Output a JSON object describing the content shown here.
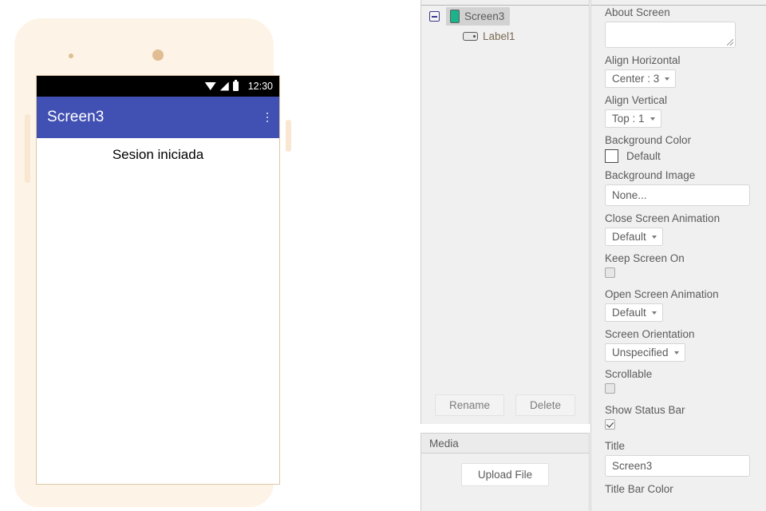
{
  "viewer": {
    "phone": {
      "status_bar": {
        "time": "12:30",
        "icons": [
          "wifi-icon",
          "signal-icon",
          "battery-icon"
        ]
      },
      "title_bar": {
        "title": "Screen3",
        "menu_icon": "overflow-menu-icon"
      },
      "content": {
        "label1_text": "Sesion iniciada"
      }
    }
  },
  "components": {
    "tree": [
      {
        "label": "Screen3",
        "icon": "screen-icon",
        "selected": true,
        "expanded": true
      },
      {
        "label": "Label1",
        "icon": "label-icon",
        "selected": false
      }
    ],
    "rename_label": "Rename",
    "delete_label": "Delete"
  },
  "media": {
    "header": "Media",
    "upload_label": "Upload File"
  },
  "properties": {
    "about_screen": {
      "label": "About Screen",
      "value": ""
    },
    "align_horizontal": {
      "label": "Align Horizontal",
      "value": "Center : 3"
    },
    "align_vertical": {
      "label": "Align Vertical",
      "value": "Top : 1"
    },
    "background_color": {
      "label": "Background Color",
      "value": "Default",
      "swatch": "#FFFFFF"
    },
    "background_image": {
      "label": "Background Image",
      "value": "None..."
    },
    "close_screen_animation": {
      "label": "Close Screen Animation",
      "value": "Default"
    },
    "keep_screen_on": {
      "label": "Keep Screen On",
      "checked": false
    },
    "open_screen_animation": {
      "label": "Open Screen Animation",
      "value": "Default"
    },
    "screen_orientation": {
      "label": "Screen Orientation",
      "value": "Unspecified"
    },
    "scrollable": {
      "label": "Scrollable",
      "checked": false
    },
    "show_status_bar": {
      "label": "Show Status Bar",
      "checked": true
    },
    "title": {
      "label": "Title",
      "value": "Screen3"
    },
    "title_bar_color": {
      "label": "Title Bar Color"
    }
  },
  "colors": {
    "title_bar": "#4150B3",
    "status_bar": "#000000",
    "phone_frame": "#FDF3E6",
    "panel_bg": "#F0F0F0",
    "tree_selected": "#D2D2D2",
    "screen_icon": "#1BB38A"
  }
}
